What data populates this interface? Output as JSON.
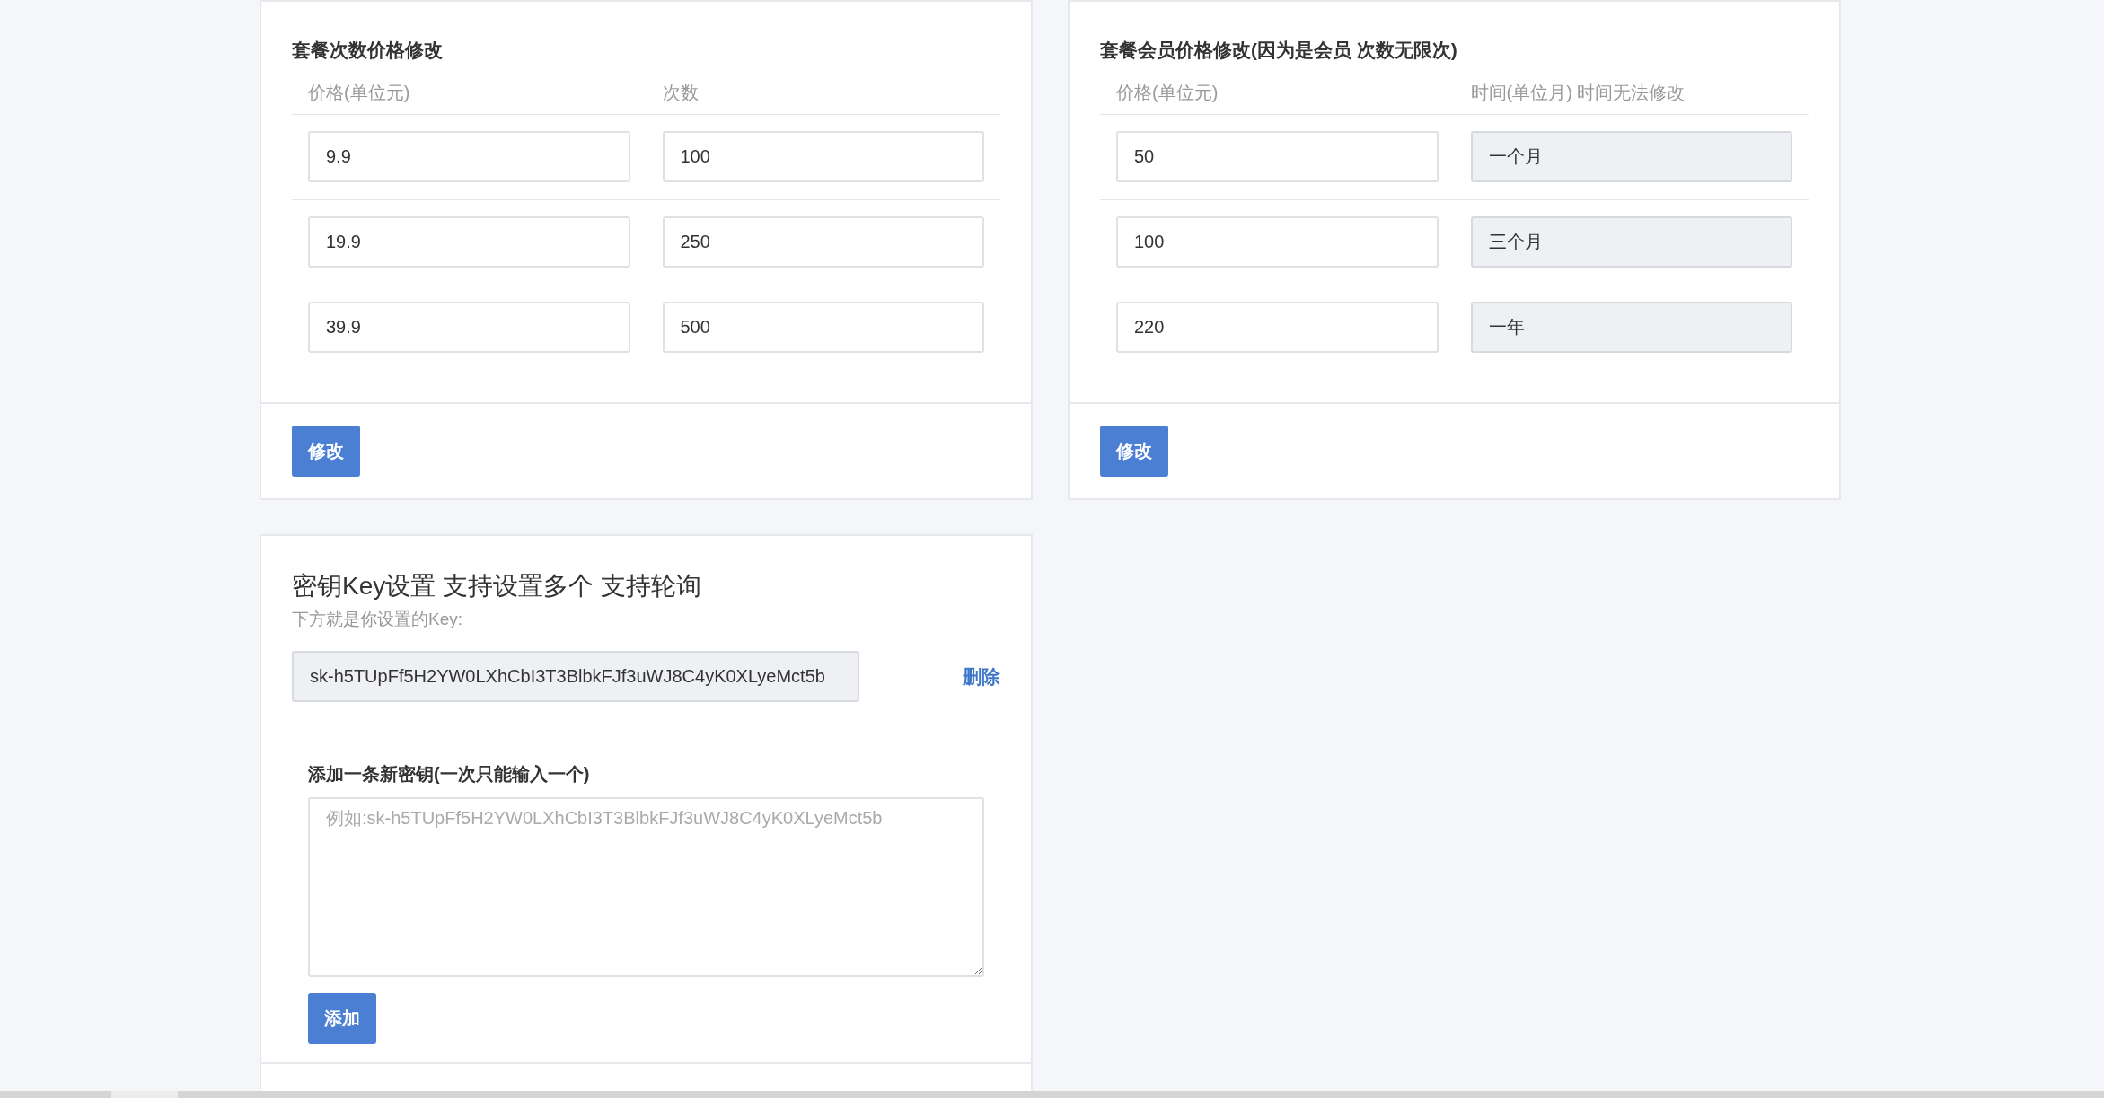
{
  "price_cards": [
    {
      "title": "套餐次数价格修改",
      "columns": [
        "价格(单位元)",
        "次数"
      ],
      "rows": [
        {
          "price": "9.9",
          "amount": "100",
          "amount_disabled": false
        },
        {
          "price": "19.9",
          "amount": "250",
          "amount_disabled": false
        },
        {
          "price": "39.9",
          "amount": "500",
          "amount_disabled": false
        }
      ],
      "button": "修改"
    },
    {
      "title": "套餐会员价格修改(因为是会员 次数无限次)",
      "columns": [
        "价格(单位元)",
        "时间(单位月) 时间无法修改"
      ],
      "rows": [
        {
          "price": "50",
          "amount": "一个月",
          "amount_disabled": true
        },
        {
          "price": "100",
          "amount": "三个月",
          "amount_disabled": true
        },
        {
          "price": "220",
          "amount": "一年",
          "amount_disabled": true
        }
      ],
      "button": "修改"
    }
  ],
  "key_card": {
    "title": "密钥Key设置 支持设置多个 支持轮询",
    "subtitle": "下方就是你设置的Key:",
    "keys": [
      {
        "value": "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",
        "disabled": true,
        "action": "删除"
      }
    ],
    "add_label": "添加一条新密钥(一次只能输入一个)",
    "add_placeholder": "例如: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",
    "add_button": "添加"
  }
}
